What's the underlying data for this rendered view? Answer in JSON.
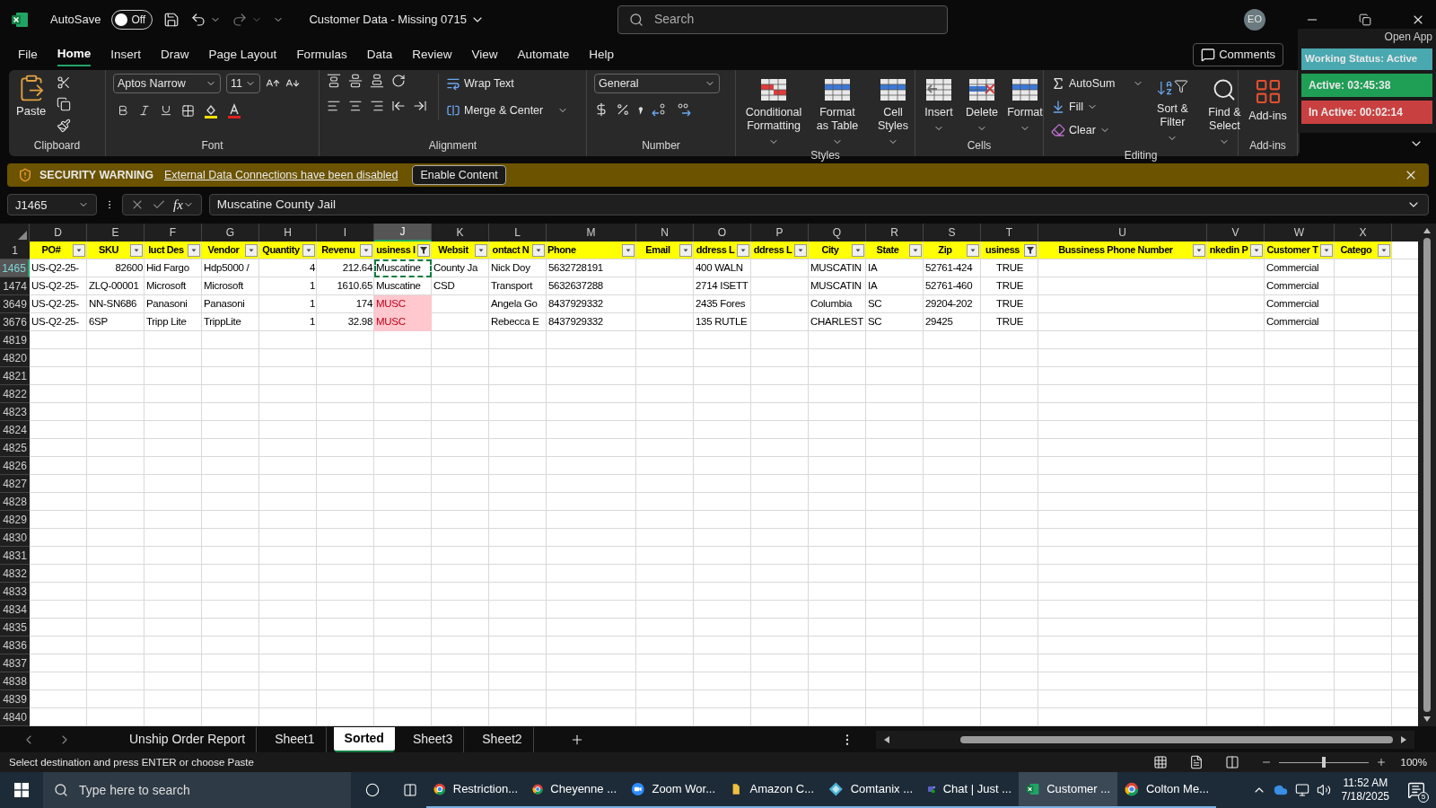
{
  "title_bar": {
    "autosave": {
      "label": "AutoSave",
      "on": false,
      "state_label": "Off"
    },
    "title": "Customer Data - Missing 0715",
    "search": {
      "placeholder": "Search"
    },
    "avatar": "EO"
  },
  "menu_tabs": [
    {
      "label": "File",
      "selected": false
    },
    {
      "label": "Home",
      "selected": true
    },
    {
      "label": "Insert",
      "selected": false
    },
    {
      "label": "Draw",
      "selected": false
    },
    {
      "label": "Page Layout",
      "selected": false
    },
    {
      "label": "Formulas",
      "selected": false
    },
    {
      "label": "Data",
      "selected": false
    },
    {
      "label": "Review",
      "selected": false
    },
    {
      "label": "View",
      "selected": false
    },
    {
      "label": "Automate",
      "selected": false
    },
    {
      "label": "Help",
      "selected": false
    }
  ],
  "comments_button": "Comments",
  "time_tracker": {
    "open_app": "Open App",
    "status": "Working Status: Active",
    "active": "Active: 03:45:38",
    "inactive": "In Active: 00:02:14"
  },
  "ribbon": {
    "clipboard": {
      "label": "Clipboard",
      "paste": "Paste"
    },
    "font": {
      "label": "Font",
      "font_name": "Aptos Narrow",
      "font_size": "11"
    },
    "alignment": {
      "label": "Alignment",
      "wrap_text": "Wrap Text",
      "merge_center": "Merge & Center"
    },
    "number": {
      "label": "Number",
      "format": "General"
    },
    "styles": {
      "label": "Styles",
      "buttons": [
        "Conditional Formatting",
        "Format as Table",
        "Cell Styles"
      ]
    },
    "cells": {
      "label": "Cells",
      "buttons": [
        "Insert",
        "Delete",
        "Format"
      ]
    },
    "editing": {
      "label": "Editing",
      "autosum": "AutoSum",
      "fill": "Fill",
      "clear": "Clear",
      "sort_filter": "Sort & Filter",
      "find_select": "Find & Select"
    },
    "addins": {
      "label": "Add-ins",
      "button": "Add-ins"
    }
  },
  "security_bar": {
    "title": "SECURITY WARNING",
    "message": "External Data Connections have been disabled",
    "button": "Enable Content"
  },
  "formula_bar": {
    "name_box": "J1465",
    "function_label": "fx",
    "value": "Muscatine County Jail"
  },
  "sheet": {
    "header_row_number": "1",
    "columns": [
      {
        "letter": "D",
        "header": "PO#",
        "filtered": false,
        "selected": false
      },
      {
        "letter": "E",
        "header": "SKU",
        "filtered": false,
        "selected": false
      },
      {
        "letter": "F",
        "header": "luct Des",
        "filtered": false,
        "selected": false
      },
      {
        "letter": "G",
        "header": "Vendor",
        "filtered": false,
        "selected": false
      },
      {
        "letter": "H",
        "header": "Quantity",
        "filtered": false,
        "selected": false
      },
      {
        "letter": "I",
        "header": "Revenu",
        "filtered": false,
        "selected": false
      },
      {
        "letter": "J",
        "header": "usiness I",
        "filtered": true,
        "selected": true
      },
      {
        "letter": "K",
        "header": "Websit",
        "filtered": false,
        "selected": false
      },
      {
        "letter": "L",
        "header": "ontact N",
        "filtered": false,
        "selected": false
      },
      {
        "letter": "M",
        "header": "Phone",
        "filtered": false,
        "selected": false
      },
      {
        "letter": "N",
        "header": "Email",
        "filtered": false,
        "selected": false
      },
      {
        "letter": "O",
        "header": "ddress L",
        "filtered": false,
        "selected": false
      },
      {
        "letter": "P",
        "header": "ddress L",
        "filtered": false,
        "selected": false
      },
      {
        "letter": "Q",
        "header": "City",
        "filtered": false,
        "selected": false
      },
      {
        "letter": "R",
        "header": "State",
        "filtered": false,
        "selected": false
      },
      {
        "letter": "S",
        "header": "Zip",
        "filtered": false,
        "selected": false
      },
      {
        "letter": "T",
        "header": "usiness",
        "filtered": true,
        "selected": false
      },
      {
        "letter": "U",
        "header": "Bussiness Phone Number",
        "filtered": false,
        "selected": false
      },
      {
        "letter": "V",
        "header": "nkedin P",
        "filtered": false,
        "selected": false
      },
      {
        "letter": "W",
        "header": "Customer T",
        "filtered": false,
        "selected": false
      },
      {
        "letter": "X",
        "header": "Catego",
        "filtered": false,
        "selected": false
      }
    ],
    "rows": [
      {
        "number": "1465",
        "selected": true,
        "cells": [
          {
            "text": "US-Q2-25-",
            "kind": "text",
            "selected": false,
            "highlight": false
          },
          {
            "text": "82600",
            "kind": "number",
            "selected": false,
            "highlight": false
          },
          {
            "text": "Hid Fargo",
            "kind": "text",
            "selected": false,
            "highlight": false
          },
          {
            "text": "Hdp5000 /",
            "kind": "text",
            "selected": false,
            "highlight": false
          },
          {
            "text": "4",
            "kind": "number",
            "selected": false,
            "highlight": false
          },
          {
            "text": "212.64",
            "kind": "number",
            "selected": false,
            "highlight": false
          },
          {
            "text": "Muscatine",
            "kind": "text",
            "selected": true,
            "highlight": false
          },
          {
            "text": "County Ja",
            "kind": "text",
            "selected": false,
            "highlight": false
          },
          {
            "text": "Nick Doy",
            "kind": "text",
            "selected": false,
            "highlight": false
          },
          {
            "text": "5632728191",
            "kind": "text",
            "selected": false,
            "highlight": false
          },
          {
            "selected": false,
            "highlight": false
          },
          {
            "text": "400 WALN",
            "kind": "text",
            "selected": false,
            "highlight": false
          },
          {
            "selected": false,
            "highlight": false
          },
          {
            "text": "MUSCATIN",
            "kind": "text",
            "selected": false,
            "highlight": false
          },
          {
            "text": "IA",
            "kind": "text",
            "selected": false,
            "highlight": false
          },
          {
            "text": "52761-424",
            "kind": "text",
            "selected": false,
            "highlight": false
          },
          {
            "text": "TRUE",
            "kind": "boolean",
            "selected": false,
            "highlight": false
          },
          {
            "selected": false,
            "highlight": false
          },
          {
            "selected": false,
            "highlight": false
          },
          {
            "text": "Commercial",
            "kind": "text",
            "selected": false,
            "highlight": false
          },
          {
            "selected": false,
            "highlight": false
          }
        ]
      },
      {
        "number": "1474",
        "selected": false,
        "cells": [
          {
            "text": "US-Q2-25-",
            "kind": "text",
            "selected": false,
            "highlight": false
          },
          {
            "text": "ZLQ-00001",
            "kind": "text",
            "selected": false,
            "highlight": false
          },
          {
            "text": "Microsoft",
            "kind": "text",
            "selected": false,
            "highlight": false
          },
          {
            "text": "Microsoft",
            "kind": "text",
            "selected": false,
            "highlight": false
          },
          {
            "text": "1",
            "kind": "number",
            "selected": false,
            "highlight": false
          },
          {
            "text": "1610.65",
            "kind": "number",
            "selected": false,
            "highlight": false
          },
          {
            "text": "Muscatine",
            "kind": "text",
            "selected": false,
            "highlight": false
          },
          {
            "text": "CSD",
            "kind": "text",
            "selected": false,
            "highlight": false
          },
          {
            "text": "Transport",
            "kind": "text",
            "selected": false,
            "highlight": false
          },
          {
            "text": "5632637288",
            "kind": "text",
            "selected": false,
            "highlight": false
          },
          {
            "selected": false,
            "highlight": false
          },
          {
            "text": "2714 ISETT",
            "kind": "text",
            "selected": false,
            "highlight": false
          },
          {
            "selected": false,
            "highlight": false
          },
          {
            "text": "MUSCATIN",
            "kind": "text",
            "selected": false,
            "highlight": false
          },
          {
            "text": "IA",
            "kind": "text",
            "selected": false,
            "highlight": false
          },
          {
            "text": "52761-460",
            "kind": "text",
            "selected": false,
            "highlight": false
          },
          {
            "text": "TRUE",
            "kind": "boolean",
            "selected": false,
            "highlight": false
          },
          {
            "selected": false,
            "highlight": false
          },
          {
            "selected": false,
            "highlight": false
          },
          {
            "text": "Commercial",
            "kind": "text",
            "selected": false,
            "highlight": false
          },
          {
            "selected": false,
            "highlight": false
          }
        ]
      },
      {
        "number": "3649",
        "selected": false,
        "cells": [
          {
            "text": "US-Q2-25-",
            "kind": "text",
            "selected": false,
            "highlight": false
          },
          {
            "text": "NN-SN686",
            "kind": "text",
            "selected": false,
            "highlight": false
          },
          {
            "text": "Panasoni",
            "kind": "text",
            "selected": false,
            "highlight": false
          },
          {
            "text": "Panasoni",
            "kind": "text",
            "selected": false,
            "highlight": false
          },
          {
            "text": "1",
            "kind": "number",
            "selected": false,
            "highlight": false
          },
          {
            "text": "174",
            "kind": "number",
            "selected": false,
            "highlight": false
          },
          {
            "text": "MUSC",
            "kind": "text",
            "selected": false,
            "highlight": true
          },
          {
            "selected": false,
            "highlight": false
          },
          {
            "text": "Angela Go",
            "kind": "text",
            "selected": false,
            "highlight": false
          },
          {
            "text": "8437929332",
            "kind": "text",
            "selected": false,
            "highlight": false
          },
          {
            "selected": false,
            "highlight": false
          },
          {
            "text": "2435 Fores",
            "kind": "text",
            "selected": false,
            "highlight": false
          },
          {
            "selected": false,
            "highlight": false
          },
          {
            "text": "Columbia",
            "kind": "text",
            "selected": false,
            "highlight": false
          },
          {
            "text": "SC",
            "kind": "text",
            "selected": false,
            "highlight": false
          },
          {
            "text": "29204-202",
            "kind": "text",
            "selected": false,
            "highlight": false
          },
          {
            "text": "TRUE",
            "kind": "boolean",
            "selected": false,
            "highlight": false
          },
          {
            "selected": false,
            "highlight": false
          },
          {
            "selected": false,
            "highlight": false
          },
          {
            "text": "Commercial",
            "kind": "text",
            "selected": false,
            "highlight": false
          },
          {
            "selected": false,
            "highlight": false
          }
        ]
      },
      {
        "number": "3676",
        "selected": false,
        "cells": [
          {
            "text": "US-Q2-25-",
            "kind": "text",
            "selected": false,
            "highlight": false
          },
          {
            "text": "6SP",
            "kind": "text",
            "selected": false,
            "highlight": false
          },
          {
            "text": "Tripp Lite",
            "kind": "text",
            "selected": false,
            "highlight": false
          },
          {
            "text": "TrippLite",
            "kind": "text",
            "selected": false,
            "highlight": false
          },
          {
            "text": "1",
            "kind": "number",
            "selected": false,
            "highlight": false
          },
          {
            "text": "32.98",
            "kind": "number",
            "selected": false,
            "highlight": false
          },
          {
            "text": "MUSC",
            "kind": "text",
            "selected": false,
            "highlight": true
          },
          {
            "selected": false,
            "highlight": false
          },
          {
            "text": "Rebecca E",
            "kind": "text",
            "selected": false,
            "highlight": false
          },
          {
            "text": "8437929332",
            "kind": "text",
            "selected": false,
            "highlight": false
          },
          {
            "selected": false,
            "highlight": false
          },
          {
            "text": "135 RUTLE",
            "kind": "text",
            "selected": false,
            "highlight": false
          },
          {
            "selected": false,
            "highlight": false
          },
          {
            "text": "CHARLEST",
            "kind": "text",
            "selected": false,
            "highlight": false
          },
          {
            "text": "SC",
            "kind": "text",
            "selected": false,
            "highlight": false
          },
          {
            "text": "29425",
            "kind": "text",
            "selected": false,
            "highlight": false
          },
          {
            "text": "TRUE",
            "kind": "boolean",
            "selected": false,
            "highlight": false
          },
          {
            "selected": false,
            "highlight": false
          },
          {
            "selected": false,
            "highlight": false
          },
          {
            "text": "Commercial",
            "kind": "text",
            "selected": false,
            "highlight": false
          },
          {
            "selected": false,
            "highlight": false
          }
        ]
      },
      {
        "number": "4819",
        "selected": false
      },
      {
        "number": "4820",
        "selected": false
      },
      {
        "number": "4821",
        "selected": false
      },
      {
        "number": "4822",
        "selected": false
      },
      {
        "number": "4823",
        "selected": false
      },
      {
        "number": "4824",
        "selected": false
      },
      {
        "number": "4825",
        "selected": false
      },
      {
        "number": "4826",
        "selected": false
      },
      {
        "number": "4827",
        "selected": false
      },
      {
        "number": "4828",
        "selected": false
      },
      {
        "number": "4829",
        "selected": false
      },
      {
        "number": "4830",
        "selected": false
      },
      {
        "number": "4831",
        "selected": false
      },
      {
        "number": "4832",
        "selected": false
      },
      {
        "number": "4833",
        "selected": false
      },
      {
        "number": "4834",
        "selected": false
      },
      {
        "number": "4835",
        "selected": false
      },
      {
        "number": "4836",
        "selected": false
      },
      {
        "number": "4837",
        "selected": false
      },
      {
        "number": "4838",
        "selected": false
      },
      {
        "number": "4839",
        "selected": false
      },
      {
        "number": "4840",
        "selected": false
      }
    ]
  },
  "sheet_tabs": [
    {
      "label": "Unship Order Report",
      "selected": false
    },
    {
      "label": "Sheet1",
      "selected": false
    },
    {
      "label": "Sorted",
      "selected": true
    },
    {
      "label": "Sheet3",
      "selected": false
    },
    {
      "label": "Sheet2",
      "selected": false
    }
  ],
  "status_bar": {
    "message": "Select destination and press ENTER or choose Paste",
    "zoom": {
      "level": 0.5,
      "label": "100%"
    }
  },
  "taskbar": {
    "search": {
      "placeholder": "Type here to search"
    },
    "apps": [
      {
        "label": "Restriction...",
        "kind": "chrome",
        "selected": false
      },
      {
        "label": "Cheyenne ...",
        "kind": "chrome",
        "selected": false
      },
      {
        "label": "Zoom Wor...",
        "kind": "zoom",
        "selected": false
      },
      {
        "label": "Amazon C...",
        "kind": "folder",
        "selected": false
      },
      {
        "label": "Comtanix ...",
        "kind": "comtanix",
        "selected": false
      },
      {
        "label": "Chat | Just ...",
        "kind": "teams",
        "selected": false
      },
      {
        "label": "Customer ...",
        "kind": "excel",
        "selected": true
      },
      {
        "label": "Colton Me...",
        "kind": "chrome",
        "selected": false
      }
    ],
    "time": "11:52 AM",
    "date": "7/18/2025",
    "notifications": "5"
  }
}
